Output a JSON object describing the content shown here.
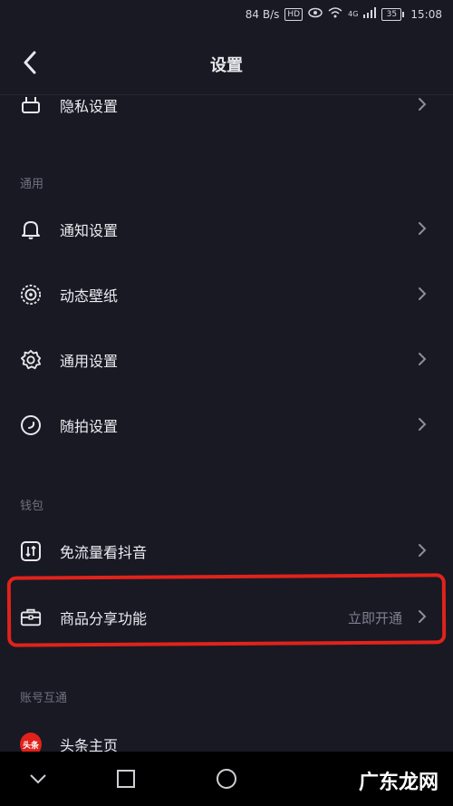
{
  "status": {
    "speed": "84 B/s",
    "hd": "HD",
    "network": "4G",
    "battery": "35",
    "time": "15:08"
  },
  "header": {
    "title": "设置"
  },
  "rows": {
    "privacy": {
      "label": "隐私设置"
    },
    "notify": {
      "label": "通知设置"
    },
    "wallpaper": {
      "label": "动态壁纸"
    },
    "general": {
      "label": "通用设置"
    },
    "snap": {
      "label": "随拍设置"
    },
    "freeflow": {
      "label": "免流量看抖音"
    },
    "goods": {
      "label": "商品分享功能",
      "value": "立即开通"
    },
    "toutiao": {
      "label": "头条主页",
      "avatar_text": "头条"
    }
  },
  "sections": {
    "general": "通用",
    "wallet": "钱包",
    "account": "账号互通"
  },
  "watermark": "广东龙网",
  "colors": {
    "background": "#181923",
    "annotation": "#e0231b",
    "toutiao": "#e1211b"
  }
}
